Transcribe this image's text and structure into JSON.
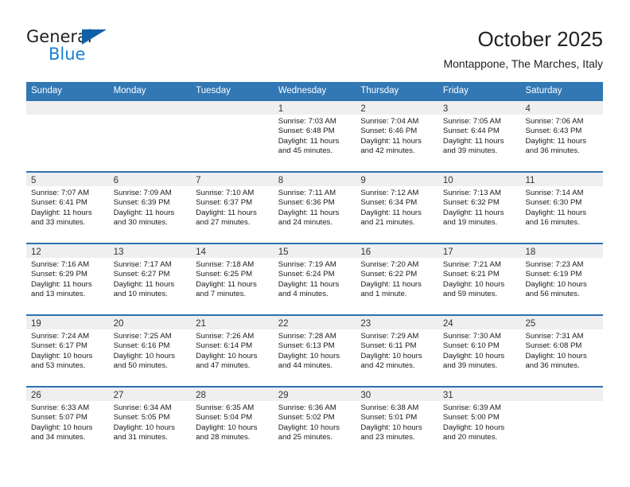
{
  "brand": {
    "name_top": "General",
    "name_bottom": "Blue",
    "triangle_color": "#1060a8",
    "blue_text_color": "#1b7fd4"
  },
  "header": {
    "title": "October 2025",
    "subtitle": "Montappone, The Marches, Italy"
  },
  "theme": {
    "header_row_bg": "#3178b5",
    "week_separator": "#2e72b0",
    "daynum_band_bg": "#efefef"
  },
  "weekdays": [
    "Sunday",
    "Monday",
    "Tuesday",
    "Wednesday",
    "Thursday",
    "Friday",
    "Saturday"
  ],
  "weeks": [
    [
      {
        "day": "",
        "sunrise": "",
        "sunset": "",
        "daylight": "",
        "empty": true
      },
      {
        "day": "",
        "sunrise": "",
        "sunset": "",
        "daylight": "",
        "empty": true
      },
      {
        "day": "",
        "sunrise": "",
        "sunset": "",
        "daylight": "",
        "empty": true
      },
      {
        "day": "1",
        "sunrise": "Sunrise: 7:03 AM",
        "sunset": "Sunset: 6:48 PM",
        "daylight": "Daylight: 11 hours and 45 minutes."
      },
      {
        "day": "2",
        "sunrise": "Sunrise: 7:04 AM",
        "sunset": "Sunset: 6:46 PM",
        "daylight": "Daylight: 11 hours and 42 minutes."
      },
      {
        "day": "3",
        "sunrise": "Sunrise: 7:05 AM",
        "sunset": "Sunset: 6:44 PM",
        "daylight": "Daylight: 11 hours and 39 minutes."
      },
      {
        "day": "4",
        "sunrise": "Sunrise: 7:06 AM",
        "sunset": "Sunset: 6:43 PM",
        "daylight": "Daylight: 11 hours and 36 minutes."
      }
    ],
    [
      {
        "day": "5",
        "sunrise": "Sunrise: 7:07 AM",
        "sunset": "Sunset: 6:41 PM",
        "daylight": "Daylight: 11 hours and 33 minutes."
      },
      {
        "day": "6",
        "sunrise": "Sunrise: 7:09 AM",
        "sunset": "Sunset: 6:39 PM",
        "daylight": "Daylight: 11 hours and 30 minutes."
      },
      {
        "day": "7",
        "sunrise": "Sunrise: 7:10 AM",
        "sunset": "Sunset: 6:37 PM",
        "daylight": "Daylight: 11 hours and 27 minutes."
      },
      {
        "day": "8",
        "sunrise": "Sunrise: 7:11 AM",
        "sunset": "Sunset: 6:36 PM",
        "daylight": "Daylight: 11 hours and 24 minutes."
      },
      {
        "day": "9",
        "sunrise": "Sunrise: 7:12 AM",
        "sunset": "Sunset: 6:34 PM",
        "daylight": "Daylight: 11 hours and 21 minutes."
      },
      {
        "day": "10",
        "sunrise": "Sunrise: 7:13 AM",
        "sunset": "Sunset: 6:32 PM",
        "daylight": "Daylight: 11 hours and 19 minutes."
      },
      {
        "day": "11",
        "sunrise": "Sunrise: 7:14 AM",
        "sunset": "Sunset: 6:30 PM",
        "daylight": "Daylight: 11 hours and 16 minutes."
      }
    ],
    [
      {
        "day": "12",
        "sunrise": "Sunrise: 7:16 AM",
        "sunset": "Sunset: 6:29 PM",
        "daylight": "Daylight: 11 hours and 13 minutes."
      },
      {
        "day": "13",
        "sunrise": "Sunrise: 7:17 AM",
        "sunset": "Sunset: 6:27 PM",
        "daylight": "Daylight: 11 hours and 10 minutes."
      },
      {
        "day": "14",
        "sunrise": "Sunrise: 7:18 AM",
        "sunset": "Sunset: 6:25 PM",
        "daylight": "Daylight: 11 hours and 7 minutes."
      },
      {
        "day": "15",
        "sunrise": "Sunrise: 7:19 AM",
        "sunset": "Sunset: 6:24 PM",
        "daylight": "Daylight: 11 hours and 4 minutes."
      },
      {
        "day": "16",
        "sunrise": "Sunrise: 7:20 AM",
        "sunset": "Sunset: 6:22 PM",
        "daylight": "Daylight: 11 hours and 1 minute."
      },
      {
        "day": "17",
        "sunrise": "Sunrise: 7:21 AM",
        "sunset": "Sunset: 6:21 PM",
        "daylight": "Daylight: 10 hours and 59 minutes."
      },
      {
        "day": "18",
        "sunrise": "Sunrise: 7:23 AM",
        "sunset": "Sunset: 6:19 PM",
        "daylight": "Daylight: 10 hours and 56 minutes."
      }
    ],
    [
      {
        "day": "19",
        "sunrise": "Sunrise: 7:24 AM",
        "sunset": "Sunset: 6:17 PM",
        "daylight": "Daylight: 10 hours and 53 minutes."
      },
      {
        "day": "20",
        "sunrise": "Sunrise: 7:25 AM",
        "sunset": "Sunset: 6:16 PM",
        "daylight": "Daylight: 10 hours and 50 minutes."
      },
      {
        "day": "21",
        "sunrise": "Sunrise: 7:26 AM",
        "sunset": "Sunset: 6:14 PM",
        "daylight": "Daylight: 10 hours and 47 minutes."
      },
      {
        "day": "22",
        "sunrise": "Sunrise: 7:28 AM",
        "sunset": "Sunset: 6:13 PM",
        "daylight": "Daylight: 10 hours and 44 minutes."
      },
      {
        "day": "23",
        "sunrise": "Sunrise: 7:29 AM",
        "sunset": "Sunset: 6:11 PM",
        "daylight": "Daylight: 10 hours and 42 minutes."
      },
      {
        "day": "24",
        "sunrise": "Sunrise: 7:30 AM",
        "sunset": "Sunset: 6:10 PM",
        "daylight": "Daylight: 10 hours and 39 minutes."
      },
      {
        "day": "25",
        "sunrise": "Sunrise: 7:31 AM",
        "sunset": "Sunset: 6:08 PM",
        "daylight": "Daylight: 10 hours and 36 minutes."
      }
    ],
    [
      {
        "day": "26",
        "sunrise": "Sunrise: 6:33 AM",
        "sunset": "Sunset: 5:07 PM",
        "daylight": "Daylight: 10 hours and 34 minutes."
      },
      {
        "day": "27",
        "sunrise": "Sunrise: 6:34 AM",
        "sunset": "Sunset: 5:05 PM",
        "daylight": "Daylight: 10 hours and 31 minutes."
      },
      {
        "day": "28",
        "sunrise": "Sunrise: 6:35 AM",
        "sunset": "Sunset: 5:04 PM",
        "daylight": "Daylight: 10 hours and 28 minutes."
      },
      {
        "day": "29",
        "sunrise": "Sunrise: 6:36 AM",
        "sunset": "Sunset: 5:02 PM",
        "daylight": "Daylight: 10 hours and 25 minutes."
      },
      {
        "day": "30",
        "sunrise": "Sunrise: 6:38 AM",
        "sunset": "Sunset: 5:01 PM",
        "daylight": "Daylight: 10 hours and 23 minutes."
      },
      {
        "day": "31",
        "sunrise": "Sunrise: 6:39 AM",
        "sunset": "Sunset: 5:00 PM",
        "daylight": "Daylight: 10 hours and 20 minutes."
      },
      {
        "day": "",
        "sunrise": "",
        "sunset": "",
        "daylight": "",
        "empty": true
      }
    ]
  ]
}
